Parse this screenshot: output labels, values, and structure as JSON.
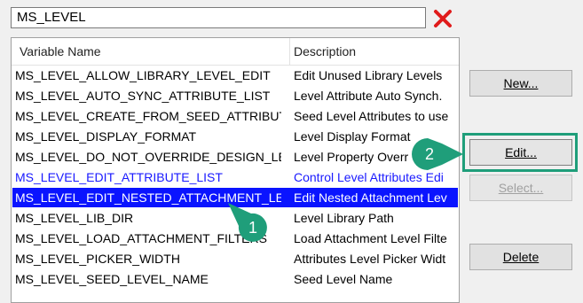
{
  "search": {
    "value": "MS_LEVEL"
  },
  "list": {
    "columns": [
      "Variable Name",
      "Description"
    ],
    "rows": [
      {
        "name": "MS_LEVEL_ALLOW_LIBRARY_LEVEL_EDIT",
        "desc": "Edit Unused Library Levels"
      },
      {
        "name": "MS_LEVEL_AUTO_SYNC_ATTRIBUTE_LIST",
        "desc": "Level Attribute Auto Synch."
      },
      {
        "name": "MS_LEVEL_CREATE_FROM_SEED_ATTRIBUTE...",
        "desc": "Seed Level Attributes to use"
      },
      {
        "name": "MS_LEVEL_DISPLAY_FORMAT",
        "desc": "Level Display Format"
      },
      {
        "name": "MS_LEVEL_DO_NOT_OVERRIDE_DESIGN_LE...",
        "desc": "Level Property Overr"
      },
      {
        "name": "MS_LEVEL_EDIT_ATTRIBUTE_LIST",
        "desc": "Control Level Attributes Edi"
      },
      {
        "name": "MS_LEVEL_EDIT_NESTED_ATTACHMENT_LE...",
        "desc": "Edit Nested Attachment Lev"
      },
      {
        "name": "MS_LEVEL_LIB_DIR",
        "desc": "Level Library Path"
      },
      {
        "name": "MS_LEVEL_LOAD_ATTACHMENT_FILTERS",
        "desc": "Load Attachment Level Filte"
      },
      {
        "name": "MS_LEVEL_PICKER_WIDTH",
        "desc": "Attributes Level Picker Widt"
      },
      {
        "name": "MS_LEVEL_SEED_LEVEL_NAME",
        "desc": "Seed Level Name"
      }
    ]
  },
  "buttons": {
    "new": {
      "label": "New..."
    },
    "edit": {
      "label": "Edit..."
    },
    "select": {
      "label": "Select..."
    },
    "delete": {
      "label": "Delete"
    }
  },
  "callouts": {
    "one": "1",
    "two": "2"
  },
  "colors": {
    "selection": "#0a14ff",
    "modified_text": "#1a1aff",
    "callout": "#1f9e7a",
    "clear_icon": "#e01b1b"
  },
  "icons": {
    "clear": "close-icon"
  }
}
